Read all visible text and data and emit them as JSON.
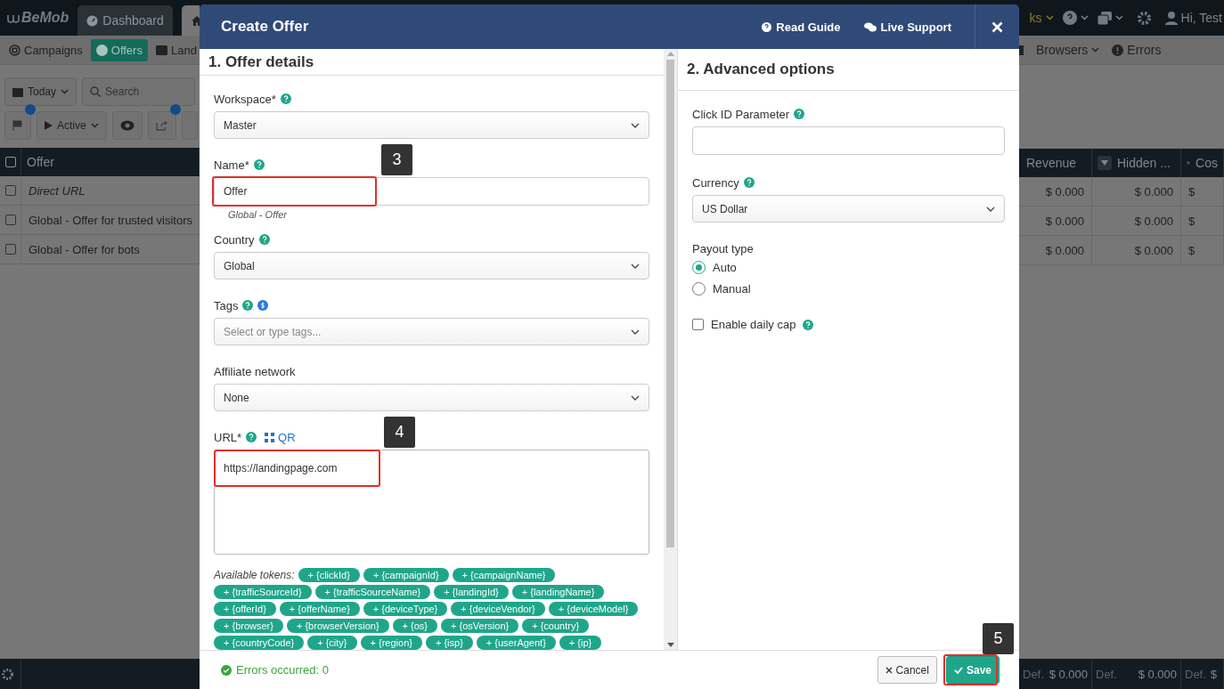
{
  "background": {
    "logo": "BeMob",
    "top_tabs": [
      {
        "label": "Dashboard",
        "selected": false
      }
    ],
    "top_menu_fragment": "ks",
    "user": "Hi, Test",
    "nav_left": [
      {
        "label": "Campaigns",
        "selected": false
      },
      {
        "label": "Offers",
        "selected": true
      },
      {
        "label": "Land",
        "selected": false
      }
    ],
    "nav_right": [
      {
        "label": "Browsers",
        "kind": "dropdown"
      },
      {
        "label": "Errors",
        "kind": "link"
      }
    ],
    "date_filter": "Today",
    "search": {
      "placeholder": "Search"
    },
    "status_filter": "Active",
    "table_left": {
      "column": "Offer",
      "checked": false,
      "rows": [
        {
          "name": "Direct URL",
          "italic": true,
          "checked": false
        },
        {
          "name": "Global - Offer for trusted visitors",
          "italic": false,
          "checked": false
        },
        {
          "name": "Global - Offer for bots",
          "italic": false,
          "checked": false
        }
      ]
    },
    "table_right": {
      "columns": [
        "Revenue",
        "Hidden ...",
        "Cos"
      ],
      "rows": [
        [
          "$ 0.000",
          "$ 0.000",
          "$"
        ],
        [
          "$ 0.000",
          "$ 0.000",
          "$"
        ],
        [
          "$ 0.000",
          "$ 0.000",
          "$"
        ]
      ]
    },
    "totals": [
      {
        "label": "Def.",
        "value": "$ 0.000"
      },
      {
        "label": "Def.",
        "value": "$ 0.000"
      },
      {
        "label": "Def.",
        "value": "$"
      }
    ]
  },
  "modal": {
    "title": "Create Offer",
    "links": [
      "Read Guide",
      "Live Support"
    ],
    "details": {
      "title": "1. Offer details",
      "workspace": {
        "label": "Workspace*",
        "value": "Master"
      },
      "name": {
        "label": "Name*",
        "value": "Offer",
        "hint": "Global - Offer",
        "annotation": "3"
      },
      "country": {
        "label": "Country",
        "value": "Global"
      },
      "tags": {
        "label": "Tags",
        "placeholder": "Select or type tags..."
      },
      "affiliate_network": {
        "label": "Affiliate network",
        "value": "None"
      },
      "url": {
        "label": "URL*",
        "qr": "QR",
        "value": "https://landingpage.com",
        "annotation": "4"
      },
      "tokens_label": "Available tokens:",
      "tokens": [
        "+ {clickId}",
        "+ {campaignId}",
        "+ {campaignName}",
        "+ {trafficSourceId}",
        "+ {trafficSourceName}",
        "+ {landingId}",
        "+ {landingName}",
        "+ {offerId}",
        "+ {offerName}",
        "+ {deviceType}",
        "+ {deviceVendor}",
        "+ {deviceModel}",
        "+ {browser}",
        "+ {browserVersion}",
        "+ {os}",
        "+ {osVersion}",
        "+ {country}",
        "+ {countryCode}",
        "+ {city}",
        "+ {region}",
        "+ {isp}",
        "+ {userAgent}",
        "+ {ip}"
      ]
    },
    "advanced": {
      "title": "2. Advanced options",
      "click_id": {
        "label": "Click ID Parameter"
      },
      "currency": {
        "label": "Currency",
        "value": "US Dollar"
      },
      "payout": {
        "label": "Payout type",
        "options": [
          {
            "label": "Auto",
            "selected": true
          },
          {
            "label": "Manual",
            "selected": false
          }
        ]
      },
      "daily_cap": {
        "label": "Enable daily cap",
        "checked": false
      }
    },
    "status": "Errors occurred: 0",
    "cancel": "Cancel",
    "save": "Save",
    "save_annotation": "5"
  }
}
